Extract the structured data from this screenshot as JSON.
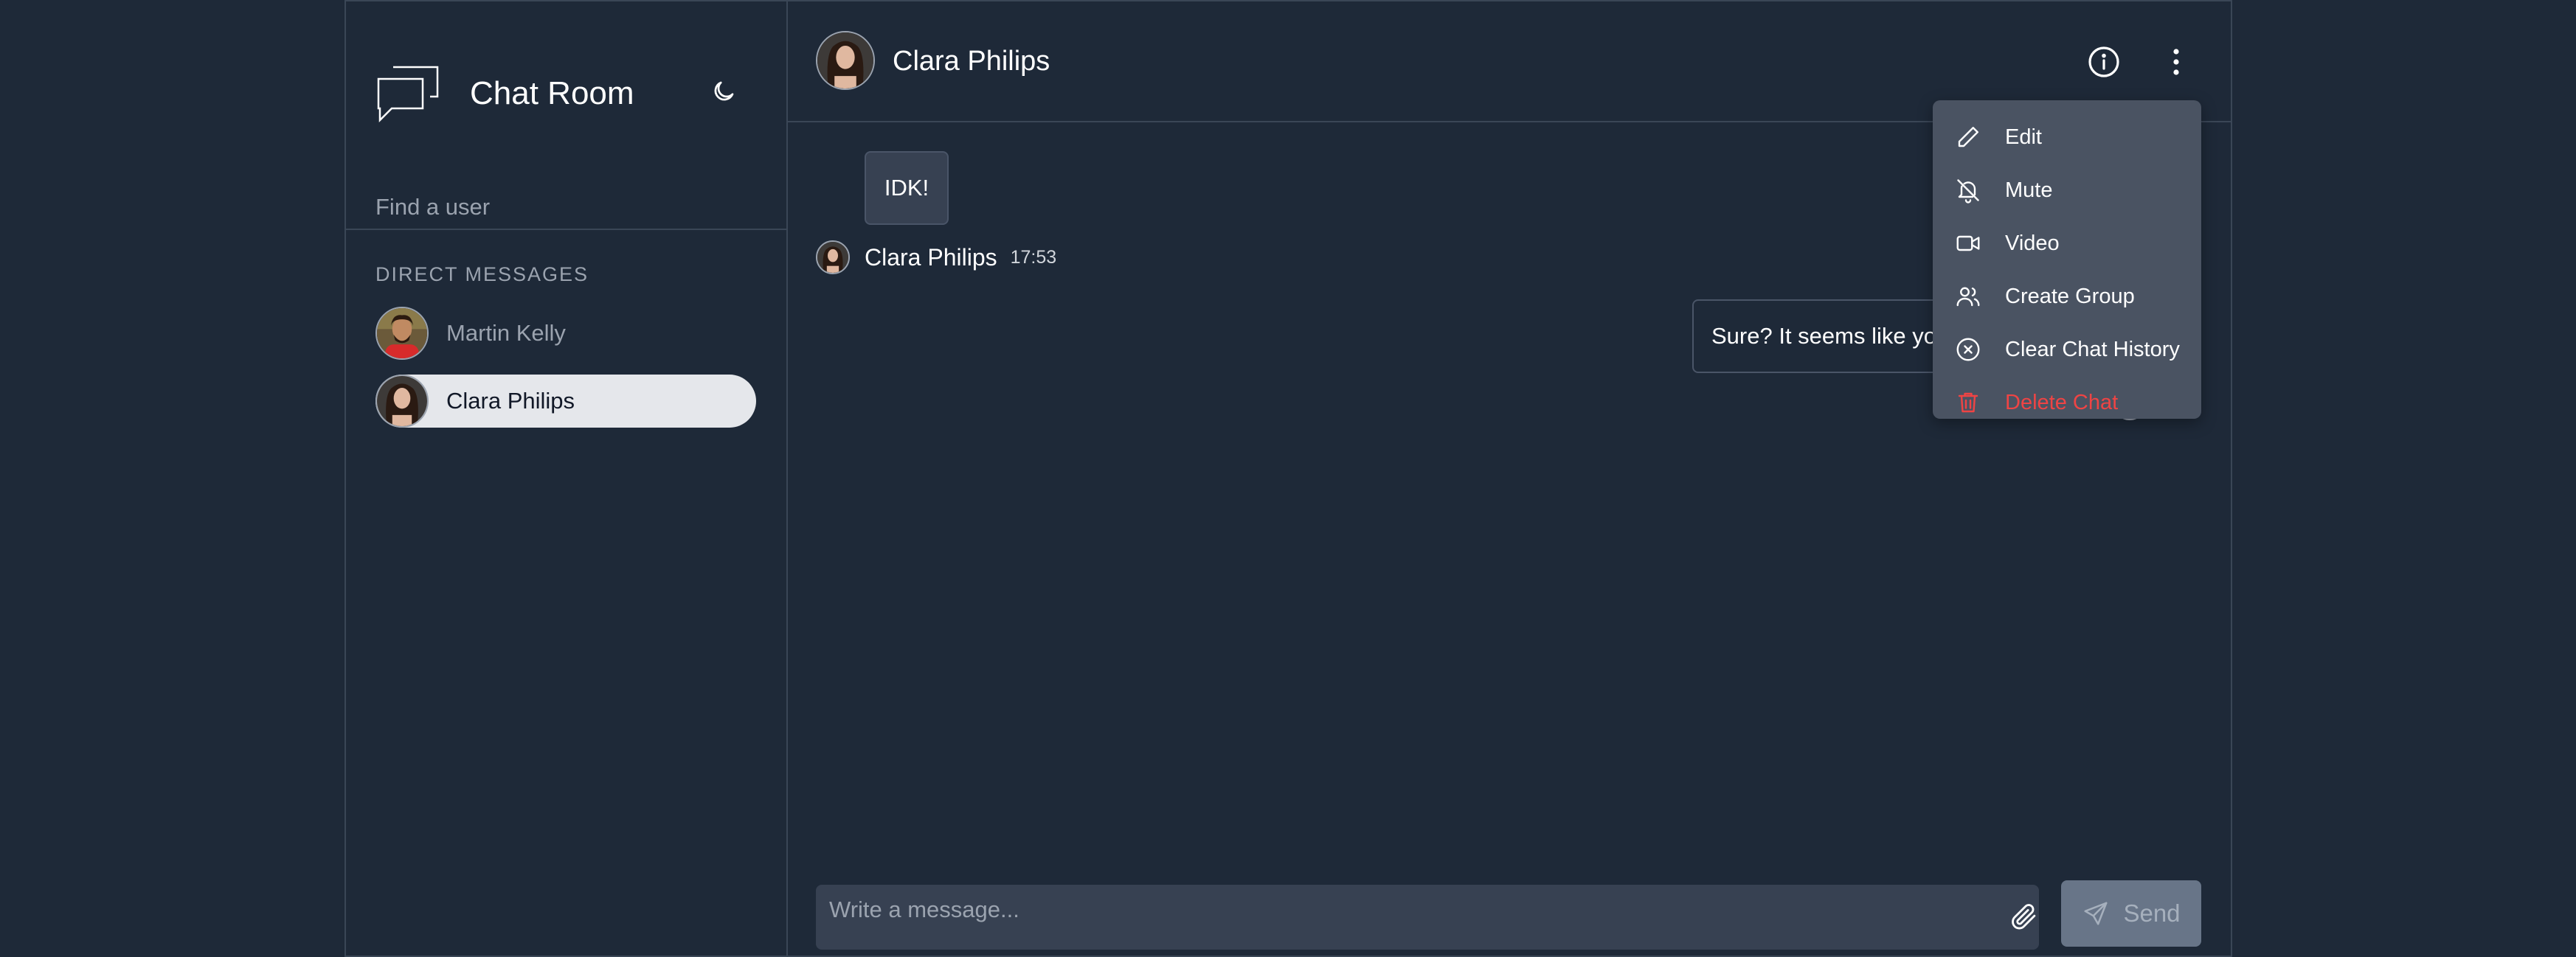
{
  "app": {
    "title": "Chat Room"
  },
  "sidebar": {
    "search_placeholder": "Find a user",
    "dm_heading": "DIRECT MESSAGES",
    "users": [
      {
        "name": "Martin Kelly",
        "active": false
      },
      {
        "name": "Clara Philips",
        "active": true
      }
    ]
  },
  "chat": {
    "contact_name": "Clara Philips",
    "messages": [
      {
        "direction": "incoming",
        "text": "IDK!",
        "sender": "Clara Philips",
        "time": "17:53"
      },
      {
        "direction": "outgoing",
        "text": "Sure? It seems like you"
      }
    ]
  },
  "menu": {
    "items": [
      {
        "label": "Edit",
        "icon": "pencil-icon"
      },
      {
        "label": "Mute",
        "icon": "bell-off-icon"
      },
      {
        "label": "Video",
        "icon": "video-icon"
      },
      {
        "label": "Create Group",
        "icon": "users-icon"
      },
      {
        "label": "Clear Chat History",
        "icon": "x-circle-icon"
      },
      {
        "label": "Delete Chat",
        "icon": "trash-icon"
      }
    ]
  },
  "composer": {
    "placeholder": "Write a message...",
    "send_label": "Send"
  },
  "colors": {
    "background": "#1e2938",
    "danger": "#ef4444",
    "menu_bg": "#4a5362",
    "active_row": "#e5e7eb"
  }
}
